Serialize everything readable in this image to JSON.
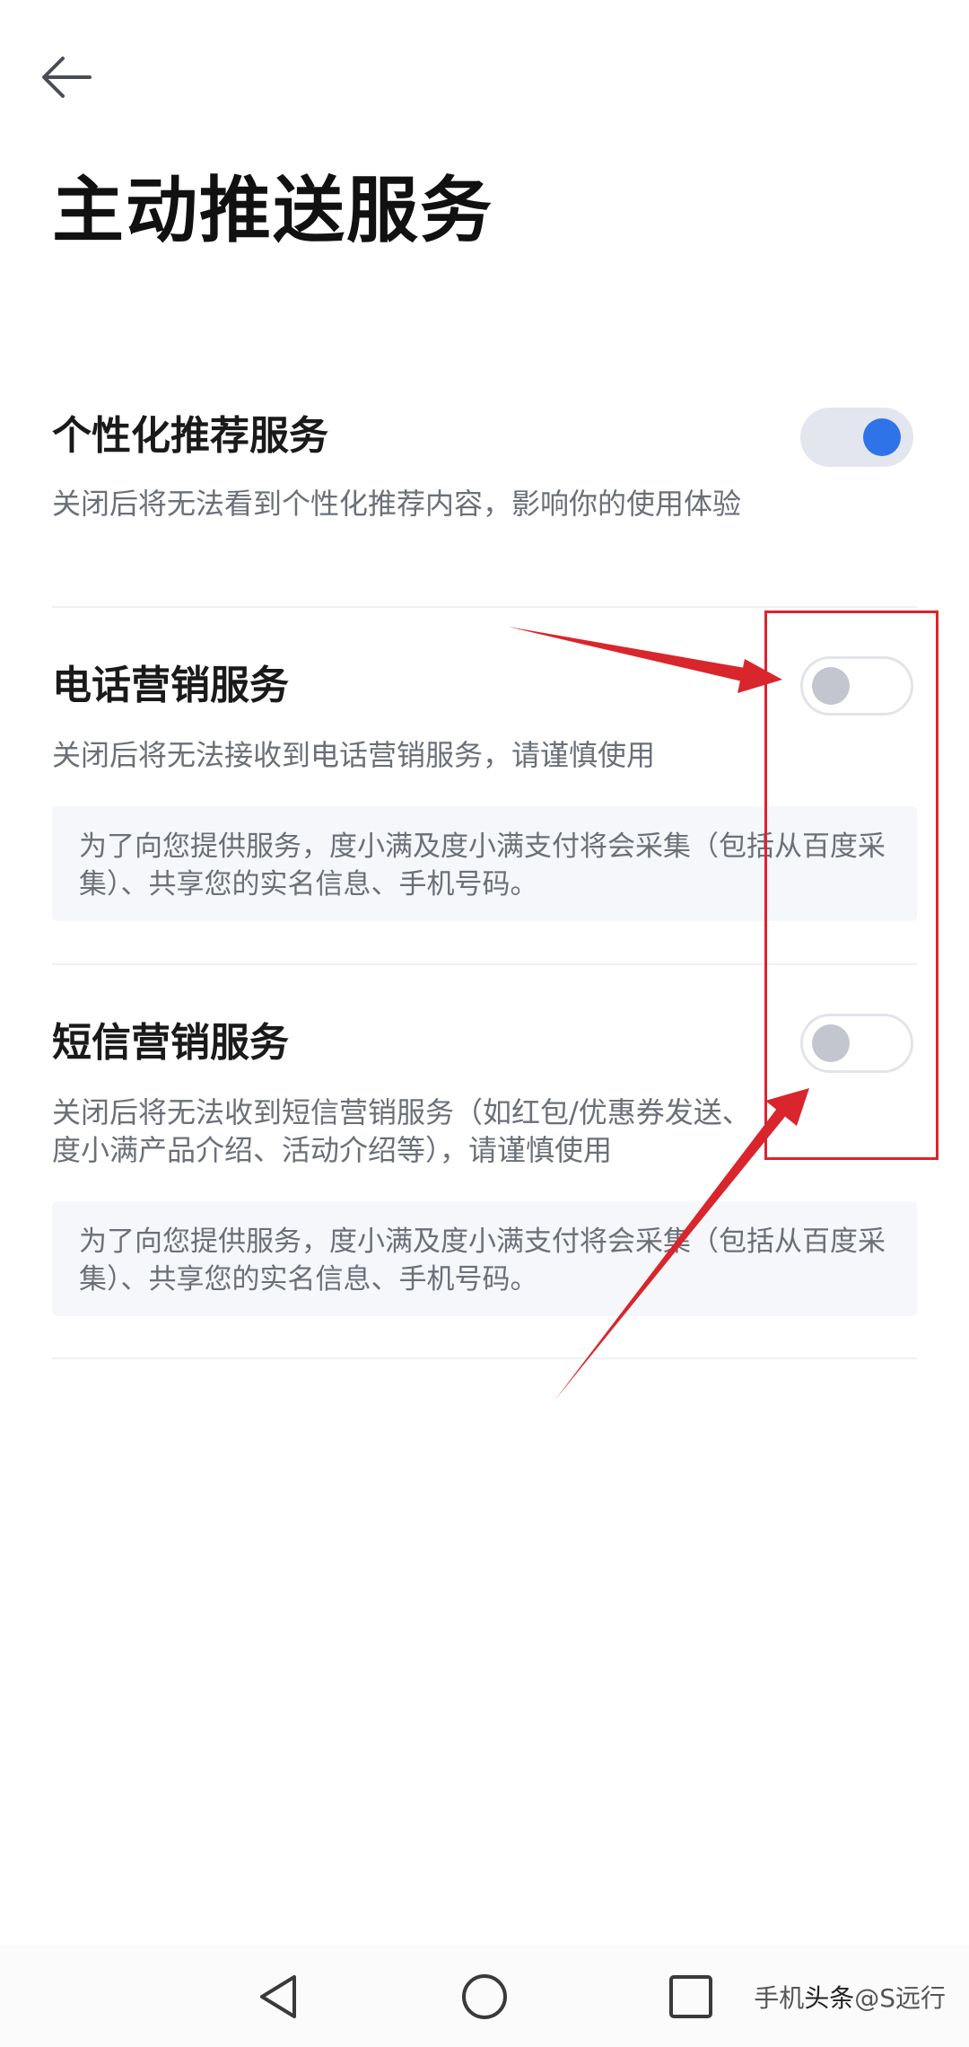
{
  "header": {
    "title": "主动推送服务"
  },
  "sections": [
    {
      "title": "个性化推荐服务",
      "description": "关闭后将无法看到个性化推荐内容，影响你的使用体验",
      "toggle_on": true
    },
    {
      "title": "电话营销服务",
      "description": "关闭后将无法接收到电话营销服务，请谨慎使用",
      "notice": "为了向您提供服务，度小满及度小满支付将会采集（包括从百度采集）、共享您的实名信息、手机号码。",
      "toggle_on": false
    },
    {
      "title": "短信营销服务",
      "description": "关闭后将无法收到短信营销服务（如红包/优惠券发送、度小满产品介绍、活动介绍等），请谨慎使用",
      "notice": "为了向您提供服务，度小满及度小满支付将会采集（包括从百度采集）、共享您的实名信息、手机号码。",
      "toggle_on": false
    }
  ],
  "navbar": {
    "icons": [
      "back-triangle-icon",
      "home-circle-icon",
      "recents-square-icon"
    ]
  },
  "watermark": {
    "prefix": "手机",
    "brand": "头条",
    "suffix": "@S远行"
  },
  "colors": {
    "accent": "#2f73e8",
    "annotation": "#d9252c",
    "toggle_off_knob": "#c3c6cf",
    "description_text": "#6b6f78"
  }
}
